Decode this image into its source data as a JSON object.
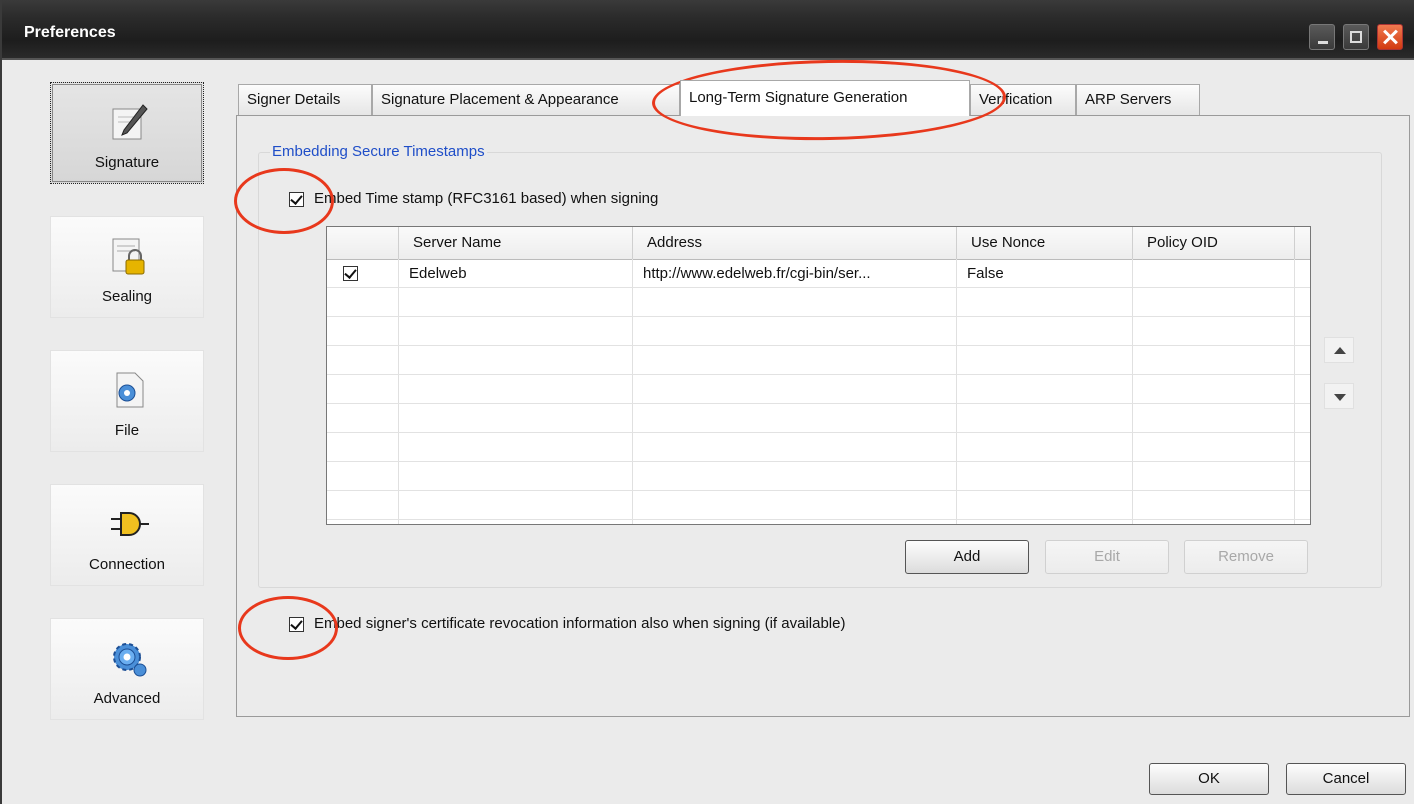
{
  "window": {
    "title": "Preferences"
  },
  "sidebar": {
    "items": [
      {
        "label": "Signature",
        "icon": "signature-pen-icon"
      },
      {
        "label": "Sealing",
        "icon": "sealing-lock-icon"
      },
      {
        "label": "File",
        "icon": "file-gear-icon"
      },
      {
        "label": "Connection",
        "icon": "plug-icon"
      },
      {
        "label": "Advanced",
        "icon": "gears-icon"
      }
    ]
  },
  "tabs": [
    {
      "label": "Signer Details"
    },
    {
      "label": "Signature Placement & Appearance"
    },
    {
      "label": "Long-Term Signature Generation"
    },
    {
      "label": "Verification"
    },
    {
      "label": "ARP Servers"
    }
  ],
  "group": {
    "title": "Embedding Secure Timestamps",
    "embed_timestamp_label": "Embed Time stamp (RFC3161 based) when signing",
    "embed_timestamp_checked": true
  },
  "grid": {
    "columns": [
      "",
      "Server Name",
      "Address",
      "Use Nonce",
      "Policy OID"
    ],
    "rows": [
      {
        "checked": true,
        "server_name": "Edelweb",
        "address": "http://www.edelweb.fr/cgi-bin/ser...",
        "use_nonce": "False",
        "policy_oid": ""
      }
    ]
  },
  "grid_buttons": {
    "add": "Add",
    "edit": "Edit",
    "remove": "Remove"
  },
  "revocation": {
    "label": "Embed signer's certificate revocation information also when signing (if available)",
    "checked": true
  },
  "footer": {
    "ok": "OK",
    "cancel": "Cancel"
  },
  "colors": {
    "annotation": "#e8381c",
    "group_title": "#1f4ec8"
  }
}
